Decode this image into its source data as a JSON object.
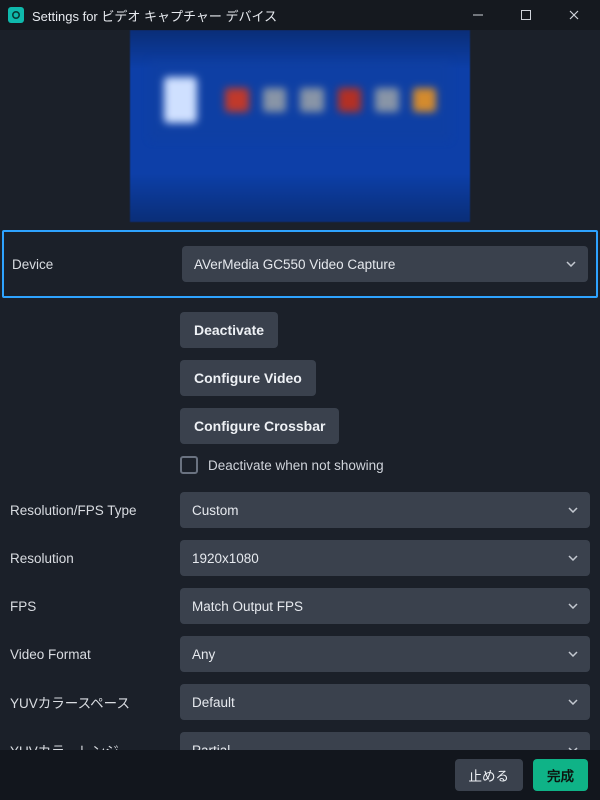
{
  "window": {
    "title": "Settings for ビデオ キャプチャー デバイス"
  },
  "fields": {
    "device": {
      "label": "Device",
      "value": "AVerMedia GC550 Video Capture"
    },
    "deactivate_button": "Deactivate",
    "configure_video_button": "Configure Video",
    "configure_crossbar_button": "Configure Crossbar",
    "deactivate_when_not_showing": {
      "label": "Deactivate when not showing",
      "checked": false
    },
    "resolution_fps_type": {
      "label": "Resolution/FPS Type",
      "value": "Custom"
    },
    "resolution": {
      "label": "Resolution",
      "value": "1920x1080"
    },
    "fps": {
      "label": "FPS",
      "value": "Match Output FPS"
    },
    "video_format": {
      "label": "Video Format",
      "value": "Any"
    },
    "yuv_color_space": {
      "label": "YUVカラースペース",
      "value": "Default"
    },
    "yuv_color_range": {
      "label": "YUVカラーレンジ",
      "value": "Partial"
    }
  },
  "footer": {
    "cancel": "止める",
    "done": "完成"
  }
}
